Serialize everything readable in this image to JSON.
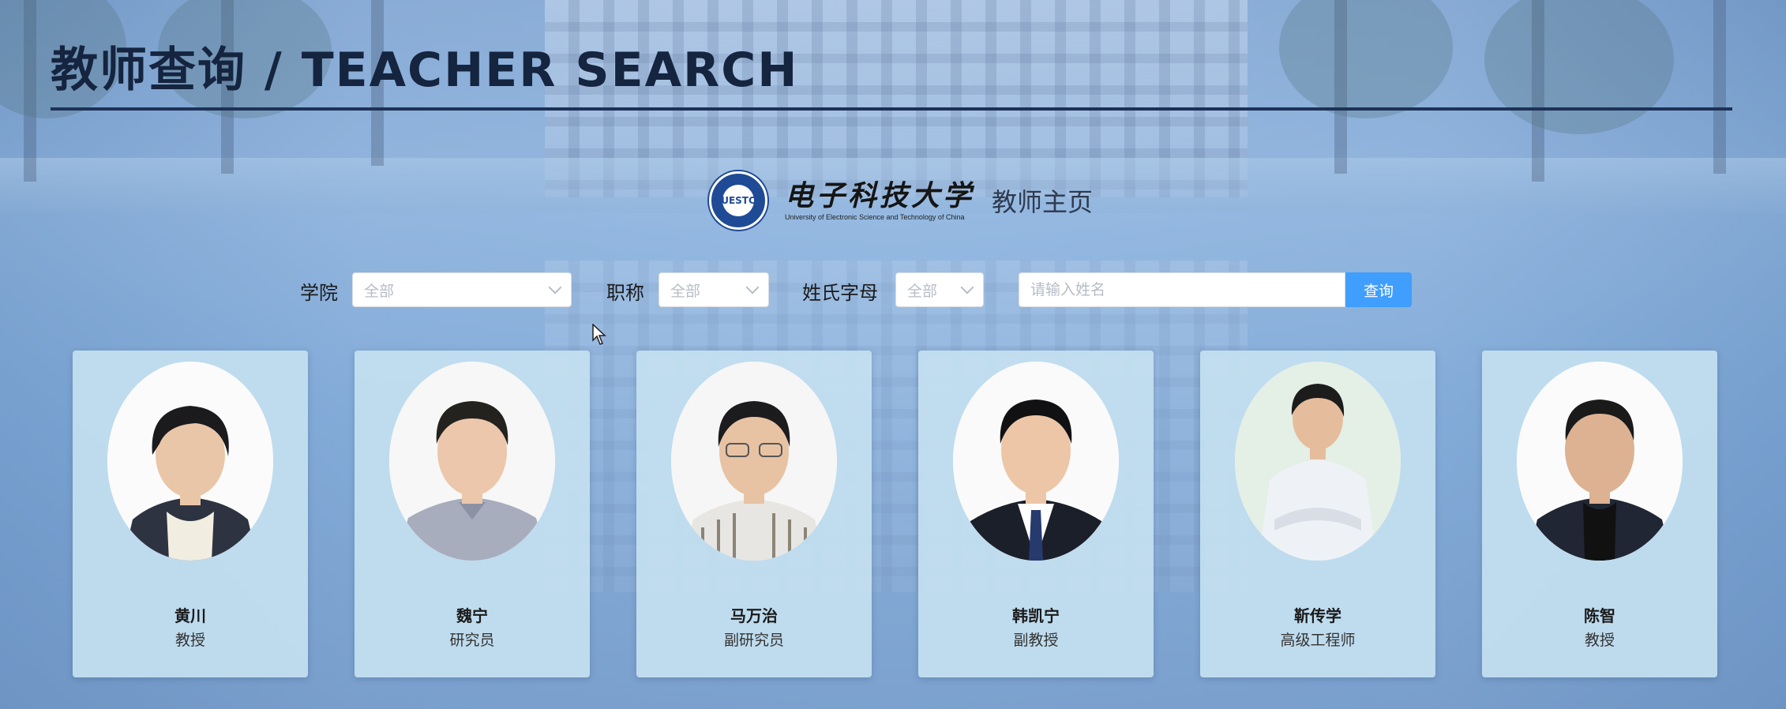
{
  "header": {
    "title": "教师查询 / TEACHER SEARCH"
  },
  "logo": {
    "seal_text": "UESTC",
    "name_cn": "电子科技大学",
    "name_en": "University of Electronic Science and Technology of China",
    "home_label": "教师主页"
  },
  "filters": {
    "college_label": "学院",
    "college_value": "全部",
    "rank_label": "职称",
    "rank_value": "全部",
    "initial_label": "姓氏字母",
    "initial_value": "全部",
    "name_placeholder": "请输入姓名",
    "search_button": "查询"
  },
  "teachers": [
    {
      "name": "黄川",
      "title": "教授"
    },
    {
      "name": "魏宁",
      "title": "研究员"
    },
    {
      "name": "马万治",
      "title": "副研究员"
    },
    {
      "name": "韩凯宁",
      "title": "副教授"
    },
    {
      "name": "靳传学",
      "title": "高级工程师"
    },
    {
      "name": "陈智",
      "title": "教授"
    }
  ],
  "colors": {
    "accent": "#409eff",
    "card_bg": "#c4e0f0",
    "title_color": "#15243f"
  }
}
